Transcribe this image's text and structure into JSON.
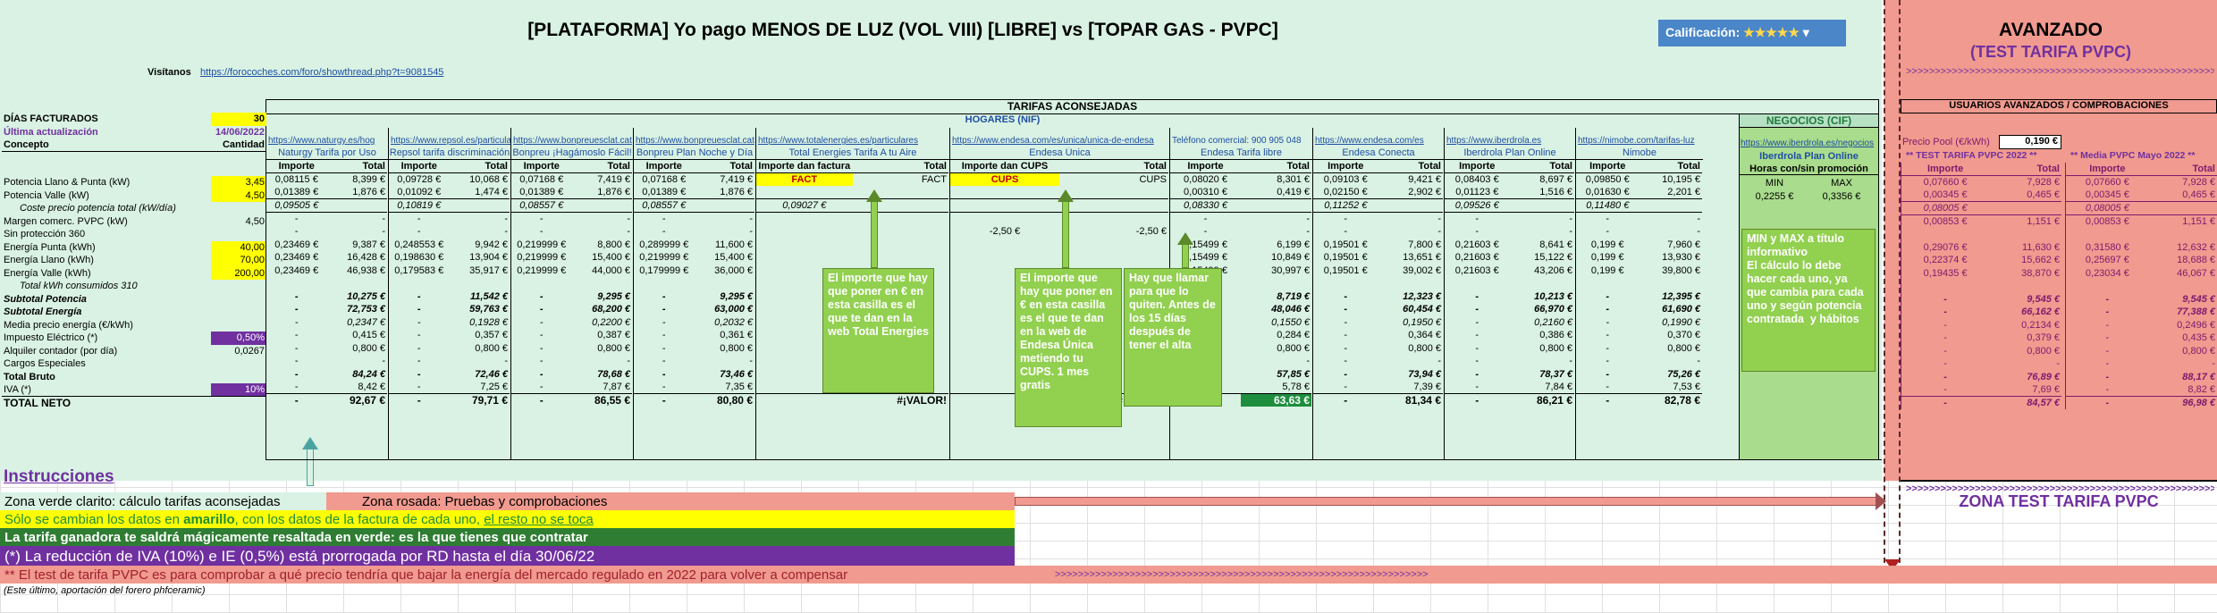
{
  "header": {
    "title": "[PLATAFORMA] Yo pago MENOS DE LUZ (VOL VIII) [LIBRE] vs [TOPAR GAS - PVPC]",
    "rating_label": "Calificación:",
    "rating_stars": "★★★★★",
    "visitors_label": "Visítanos",
    "visitors_link": "https://forocoches.com/foro/showthread.php?t=9081545"
  },
  "advanced": {
    "title": "AVANZADO",
    "subtitle": "(TEST TARIFA PVPC)",
    "chevrons": ">>>>>>>>>>>>>>>>>>>>>>>>>>>>>>>>>>>>>>>>>>>>>>>>>>>>>>>>>>>>>>>>>",
    "users_header": "USUARIOS AVANZADOS / COMPROBACIONES",
    "pool_label": "Precio Pool (€/kWh)",
    "pool_value": "0,190 €",
    "test_header": "** TEST TARIFA PVPC 2022 **",
    "media_header": "** Media PVPC Mayo 2022 **",
    "zone_label": "ZONA TEST TARIFA PVPC"
  },
  "sections": {
    "tarifas": "TARIFAS ACONSEJADAS",
    "hogares": "HOGARES (NIF)",
    "negocios": "NEGOCIOS (CIF)"
  },
  "left": {
    "dias_label": "DÍAS FACTURADOS",
    "dias_value": "30",
    "ultima_label": "Última actualización",
    "ultima_value": "14/06/2022",
    "concepto": "Concepto",
    "cantidad": "Cantidad",
    "rows": [
      {
        "label": "Potencia Llano & Punta (kW)",
        "qty": "3,45",
        "hl": "yel"
      },
      {
        "label": "Potencia Valle (kW)",
        "qty": "4,50",
        "hl": "yel"
      },
      {
        "label": "Coste precio potencia total (kW/día)",
        "qty": "",
        "hl": "",
        "indent": true,
        "italic": true
      },
      {
        "label": "Margen comerc. PVPC (kW)",
        "qty": "4,50",
        "hl": ""
      },
      {
        "label": "Sin protección 360",
        "qty": "",
        "hl": ""
      },
      {
        "label": "Energía Punta (kWh)",
        "qty": "40,00",
        "hl": "yel"
      },
      {
        "label": "Energía Llano (kWh)",
        "qty": "70,00",
        "hl": "yel"
      },
      {
        "label": "Energía Valle (kWh)",
        "qty": "200,00",
        "hl": "yel"
      },
      {
        "label": "Total kWh consumidos  310",
        "qty": "",
        "hl": "",
        "indent": true,
        "italic": true
      },
      {
        "label": "Subtotal Potencia",
        "qty": "",
        "hl": "",
        "bold": true,
        "italic": true
      },
      {
        "label": "Subtotal Energía",
        "qty": "",
        "hl": "",
        "bold": true,
        "italic": true
      },
      {
        "label": "Media precio energía (€/kWh)",
        "qty": "",
        "hl": ""
      },
      {
        "label": "Impuesto Eléctrico (*)",
        "qty": "0,50%",
        "hl": "pur"
      },
      {
        "label": "Alquiler contador (por día)",
        "qty": "0,0267",
        "hl": ""
      },
      {
        "label": "Cargos Especiales",
        "qty": "",
        "hl": ""
      },
      {
        "label": "Total Bruto",
        "qty": "",
        "hl": "",
        "bold": true
      },
      {
        "label": "IVA (*)",
        "qty": "10%",
        "hl": "pur"
      },
      {
        "label": "TOTAL NETO",
        "qty": "",
        "hl": "",
        "bold": true,
        "big": true
      }
    ]
  },
  "providers": [
    {
      "link": "https://www.naturgy.es/hog",
      "name": "Naturgy Tarifa por Uso",
      "cols": [
        "Importe",
        "Total"
      ],
      "vals": [
        [
          "0,08115 €",
          "8,399 €"
        ],
        [
          "0,01389 €",
          "1,876 €"
        ],
        [
          "0,09505 €",
          ""
        ],
        [
          "-",
          "-"
        ],
        [
          "-",
          "-"
        ],
        [
          "0,23469 €",
          "9,387 €"
        ],
        [
          "0,23469 €",
          "16,428 €"
        ],
        [
          "0,23469 €",
          "46,938 €"
        ],
        [
          "",
          ""
        ],
        [
          "-",
          "10,275 €"
        ],
        [
          "-",
          "72,753 €"
        ],
        [
          "-",
          "0,2347 €"
        ],
        [
          "-",
          "0,415 €"
        ],
        [
          "-",
          "0,800 €"
        ],
        [
          "-",
          "-"
        ],
        [
          "-",
          "84,24 €"
        ],
        [
          "-",
          "8,42 €"
        ],
        [
          "-",
          "92,67 €"
        ]
      ]
    },
    {
      "link": "https://www.repsol.es/particulares",
      "name": "Repsol tarifa discriminación",
      "cols": [
        "Importe",
        "Total"
      ],
      "vals": [
        [
          "0,09728 €",
          "10,068 €"
        ],
        [
          "0,01092 €",
          "1,474 €"
        ],
        [
          "0,10819 €",
          ""
        ],
        [
          "-",
          "-"
        ],
        [
          "-",
          "-"
        ],
        [
          "0,248553 €",
          "9,942 €"
        ],
        [
          "0,198630 €",
          "13,904 €"
        ],
        [
          "0,179583 €",
          "35,917 €"
        ],
        [
          "",
          ""
        ],
        [
          "-",
          "11,542 €"
        ],
        [
          "-",
          "59,763 €"
        ],
        [
          "-",
          "0,1928 €"
        ],
        [
          "-",
          "0,357 €"
        ],
        [
          "-",
          "0,800 €"
        ],
        [
          "-",
          "-"
        ],
        [
          "-",
          "72,46 €"
        ],
        [
          "-",
          "7,25 €"
        ],
        [
          "-",
          "79,71 €"
        ]
      ]
    },
    {
      "link": "https://www.bonpreuesclat.cat",
      "name": "Bonpreu ¡Hagámoslo Fácil!",
      "cols": [
        "Importe",
        "Total"
      ],
      "vals": [
        [
          "0,07168 €",
          "7,419 €"
        ],
        [
          "0,01389 €",
          "1,876 €"
        ],
        [
          "0,08557 €",
          ""
        ],
        [
          "-",
          "-"
        ],
        [
          "-",
          "-"
        ],
        [
          "0,219999 €",
          "8,800 €"
        ],
        [
          "0,219999 €",
          "15,400 €"
        ],
        [
          "0,219999 €",
          "44,000 €"
        ],
        [
          "",
          ""
        ],
        [
          "-",
          "9,295 €"
        ],
        [
          "-",
          "68,200 €"
        ],
        [
          "-",
          "0,2200 €"
        ],
        [
          "-",
          "0,387 €"
        ],
        [
          "-",
          "0,800 €"
        ],
        [
          "-",
          "-"
        ],
        [
          "-",
          "78,68 €"
        ],
        [
          "-",
          "7,87 €"
        ],
        [
          "-",
          "86,55 €"
        ]
      ]
    },
    {
      "link": "https://www.bonpreuesclat.cat",
      "name": "Bonpreu Plan Noche y Día",
      "cols": [
        "Importe",
        "Total"
      ],
      "vals": [
        [
          "0,07168 €",
          "7,419 €"
        ],
        [
          "0,01389 €",
          "1,876 €"
        ],
        [
          "0,08557 €",
          ""
        ],
        [
          "-",
          "-"
        ],
        [
          "-",
          "-"
        ],
        [
          "0,289999 €",
          "11,600 €"
        ],
        [
          "0,219999 €",
          "15,400 €"
        ],
        [
          "0,179999 €",
          "36,000 €"
        ],
        [
          "",
          ""
        ],
        [
          "-",
          "9,295 €"
        ],
        [
          "-",
          "63,000 €"
        ],
        [
          "-",
          "0,2032 €"
        ],
        [
          "-",
          "0,361 €"
        ],
        [
          "-",
          "0,800 €"
        ],
        [
          "-",
          "-"
        ],
        [
          "-",
          "73,46 €"
        ],
        [
          "-",
          "7,35 €"
        ],
        [
          "-",
          "80,80 €"
        ]
      ]
    },
    {
      "link": "https://www.totalenergies.es/particulares",
      "name": "Total Energies Tarifa A tu Aire",
      "cols": [
        "Importe dan factura",
        "Total"
      ],
      "vals": [
        [
          "FACT",
          "FACT"
        ],
        [
          "",
          ""
        ],
        [
          "0,09027 €",
          ""
        ],
        [
          "",
          ""
        ],
        [
          "",
          ""
        ],
        [
          "",
          ""
        ],
        [
          "",
          ""
        ],
        [
          "",
          ""
        ],
        [
          "",
          ""
        ],
        [
          "",
          ""
        ],
        [
          "",
          ""
        ],
        [
          "",
          ""
        ],
        [
          "",
          ""
        ],
        [
          "",
          ""
        ],
        [
          "",
          ""
        ],
        [
          "",
          ""
        ],
        [
          "",
          ""
        ],
        [
          "",
          "#¡VALOR!"
        ]
      ]
    },
    {
      "link": "https://www.endesa.com/es/unica/unica-de-endesa",
      "name": "Endesa Única",
      "cols": [
        "Importe dan CUPS",
        "Total"
      ],
      "vals": [
        [
          "CUPS",
          "CUPS"
        ],
        [
          "",
          ""
        ],
        [
          "",
          ""
        ],
        [
          "",
          ""
        ],
        [
          "-2,50 €",
          "-2,50 €"
        ],
        [
          "",
          ""
        ],
        [
          "",
          ""
        ],
        [
          "",
          ""
        ],
        [
          "",
          ""
        ],
        [
          "",
          ""
        ],
        [
          "",
          ""
        ],
        [
          "",
          ""
        ],
        [
          "",
          ""
        ],
        [
          "",
          ""
        ],
        [
          "",
          ""
        ],
        [
          "",
          ""
        ],
        [
          "",
          ""
        ],
        [
          "",
          "#¡VALOR!"
        ]
      ]
    },
    {
      "link": "Teléfono comercial: 900 905 048",
      "name": "Endesa Tarifa libre",
      "cols": [
        "Importe",
        "Total"
      ],
      "vals": [
        [
          "0,08020 €",
          "8,301 €"
        ],
        [
          "0,00310 €",
          "0,419 €"
        ],
        [
          "0,08330 €",
          ""
        ],
        [
          "-",
          "-"
        ],
        [
          "-",
          "-"
        ],
        [
          "0,15499 €",
          "6,199 €"
        ],
        [
          "0,15499 €",
          "10,849 €"
        ],
        [
          "0,15499 €",
          "30,997 €"
        ],
        [
          "",
          ""
        ],
        [
          "-",
          "8,719 €"
        ],
        [
          "-",
          "48,046 €"
        ],
        [
          "-",
          "0,1550 €"
        ],
        [
          "-",
          "0,284 €"
        ],
        [
          "-",
          "0,800 €"
        ],
        [
          "-",
          "-"
        ],
        [
          "-",
          "57,85 €"
        ],
        [
          "-",
          "5,78 €"
        ],
        [
          "-",
          "63,63 €"
        ]
      ]
    },
    {
      "link": "https://www.endesa.com/es",
      "name": "Endesa Conecta",
      "cols": [
        "Importe",
        "Total"
      ],
      "vals": [
        [
          "0,09103 €",
          "9,421 €"
        ],
        [
          "0,02150 €",
          "2,902 €"
        ],
        [
          "0,11252 €",
          ""
        ],
        [
          "-",
          "-"
        ],
        [
          "-",
          "-"
        ],
        [
          "0,19501 €",
          "7,800 €"
        ],
        [
          "0,19501 €",
          "13,651 €"
        ],
        [
          "0,19501 €",
          "39,002 €"
        ],
        [
          "",
          ""
        ],
        [
          "-",
          "12,323 €"
        ],
        [
          "-",
          "60,454 €"
        ],
        [
          "-",
          "0,1950 €"
        ],
        [
          "-",
          "0,364 €"
        ],
        [
          "-",
          "0,800 €"
        ],
        [
          "-",
          "-"
        ],
        [
          "-",
          "73,94 €"
        ],
        [
          "-",
          "7,39 €"
        ],
        [
          "-",
          "81,34 €"
        ]
      ]
    },
    {
      "link": "https://www.iberdrola.es",
      "name": "Iberdrola Plan Online",
      "cols": [
        "Importe",
        "Total"
      ],
      "vals": [
        [
          "0,08403 €",
          "8,697 €"
        ],
        [
          "0,01123 €",
          "1,516 €"
        ],
        [
          "0,09526 €",
          ""
        ],
        [
          "-",
          "-"
        ],
        [
          "-",
          "-"
        ],
        [
          "0,21603 €",
          "8,641 €"
        ],
        [
          "0,21603 €",
          "15,122 €"
        ],
        [
          "0,21603 €",
          "43,206 €"
        ],
        [
          "",
          ""
        ],
        [
          "-",
          "10,213 €"
        ],
        [
          "-",
          "66,970 €"
        ],
        [
          "-",
          "0,2160 €"
        ],
        [
          "-",
          "0,386 €"
        ],
        [
          "-",
          "0,800 €"
        ],
        [
          "-",
          "-"
        ],
        [
          "-",
          "78,37 €"
        ],
        [
          "-",
          "7,84 €"
        ],
        [
          "-",
          "86,21 €"
        ]
      ]
    },
    {
      "link": "https://nimobe.com/tarifas-luz",
      "name": "Nimobe",
      "cols": [
        "Importe",
        "Total"
      ],
      "vals": [
        [
          "0,09850 €",
          "10,195 €"
        ],
        [
          "0,01630 €",
          "2,201 €"
        ],
        [
          "0,11480 €",
          ""
        ],
        [
          "-",
          "-"
        ],
        [
          "-",
          "-"
        ],
        [
          "0,199 €",
          "7,960 €"
        ],
        [
          "0,199 €",
          "13,930 €"
        ],
        [
          "0,199 €",
          "39,800 €"
        ],
        [
          "",
          ""
        ],
        [
          "-",
          "12,395 €"
        ],
        [
          "-",
          "61,690 €"
        ],
        [
          "-",
          "0,1990 €"
        ],
        [
          "-",
          "0,370 €"
        ],
        [
          "-",
          "0,800 €"
        ],
        [
          "-",
          "-"
        ],
        [
          "-",
          "75,26 €"
        ],
        [
          "-",
          "7,53 €"
        ],
        [
          "-",
          "82,78 €"
        ]
      ]
    }
  ],
  "negocio": {
    "link": "https://www.iberdrola.es/negocios",
    "name": "Iberdrola Plan Online",
    "sub": "Horas con/sin promoción",
    "min_label": "MIN",
    "max_label": "MAX",
    "min_val": "0,2255 €",
    "max_val": "0,3356 €",
    "note": "MIN y MAX a título informativo\nEl cálculo lo debe hacer cada uno, ya que cambia para cada uno y según potencia contratada  y hábitos"
  },
  "pvpc_test": {
    "cols": [
      "Importe",
      "Total"
    ],
    "vals": [
      [
        "0,07660 €",
        "7,928 €"
      ],
      [
        "0,00345 €",
        "0,465 €"
      ],
      [
        "0,08005 €",
        ""
      ],
      [
        "0,00853 €",
        "1,151 €"
      ],
      [
        "",
        ""
      ],
      [
        "0,29076 €",
        "11,630 €"
      ],
      [
        "0,22374 €",
        "15,662 €"
      ],
      [
        "0,19435 €",
        "38,870 €"
      ],
      [
        "",
        ""
      ],
      [
        "-",
        "9,545 €"
      ],
      [
        "-",
        "66,162 €"
      ],
      [
        "-",
        "0,2134 €"
      ],
      [
        "-",
        "0,379 €"
      ],
      [
        "-",
        "0,800 €"
      ],
      [
        "-",
        "-"
      ],
      [
        "-",
        "76,89 €"
      ],
      [
        "-",
        "7,69 €"
      ],
      [
        "-",
        "84,57 €"
      ]
    ]
  },
  "pvpc_media": {
    "cols": [
      "Importe",
      "Total"
    ],
    "vals": [
      [
        "0,07660 €",
        "7,928 €"
      ],
      [
        "0,00345 €",
        "0,465 €"
      ],
      [
        "0,08005 €",
        ""
      ],
      [
        "0,00853 €",
        "1,151 €"
      ],
      [
        "",
        ""
      ],
      [
        "0,31580 €",
        "12,632 €"
      ],
      [
        "0,25697 €",
        "18,688 €"
      ],
      [
        "0,23034 €",
        "46,067 €"
      ],
      [
        "",
        ""
      ],
      [
        "-",
        "9,545 €"
      ],
      [
        "-",
        "77,388 €"
      ],
      [
        "-",
        "0,2496 €"
      ],
      [
        "-",
        "0,435 €"
      ],
      [
        "-",
        "0,800 €"
      ],
      [
        "-",
        "-"
      ],
      [
        "-",
        "88,17 €"
      ],
      [
        "-",
        "8,82 €"
      ],
      [
        "-",
        "96,98 €"
      ]
    ]
  },
  "notes": {
    "total": "El importe que hay que poner en € en esta casilla es el que te dan en la web Total Energies",
    "endesa1": "El importe que hay que poner en € en esta casilla es el que te dan en la web de Endesa Única metiendo tu CUPS. 1 mes gratis",
    "endesa2": "Hay que llamar para que lo quiten. Antes de los 15 días después de tener el alta"
  },
  "instructions": {
    "title": "Instrucciones",
    "green_zone": "Zona verde clarito: cálculo tarifas aconsejadas",
    "pink_zone": "Zona rosada: Pruebas y comprobaciones",
    "yellow_a": "Sólo se cambian los datos en ",
    "yellow_b": "amarillo",
    "yellow_c": ", con los datos de la factura de cada uno, ",
    "yellow_d": "el resto no se toca",
    "winner": "La tarifa ganadora te saldrá mágicamente resaltada en verde: es la que tienes que contratar",
    "iva": "(*) La reducción de IVA (10%) e IE (0,5%) está prorrogada por RD hasta el día 30/06/22",
    "pvpc": "** El test de tarifa PVPC es para comprobar a qué precio tendría que bajar la energía del mercado regulado en 2022 para volver a compensar",
    "footer": "(Este último, aportación del forero phfceramic)"
  }
}
